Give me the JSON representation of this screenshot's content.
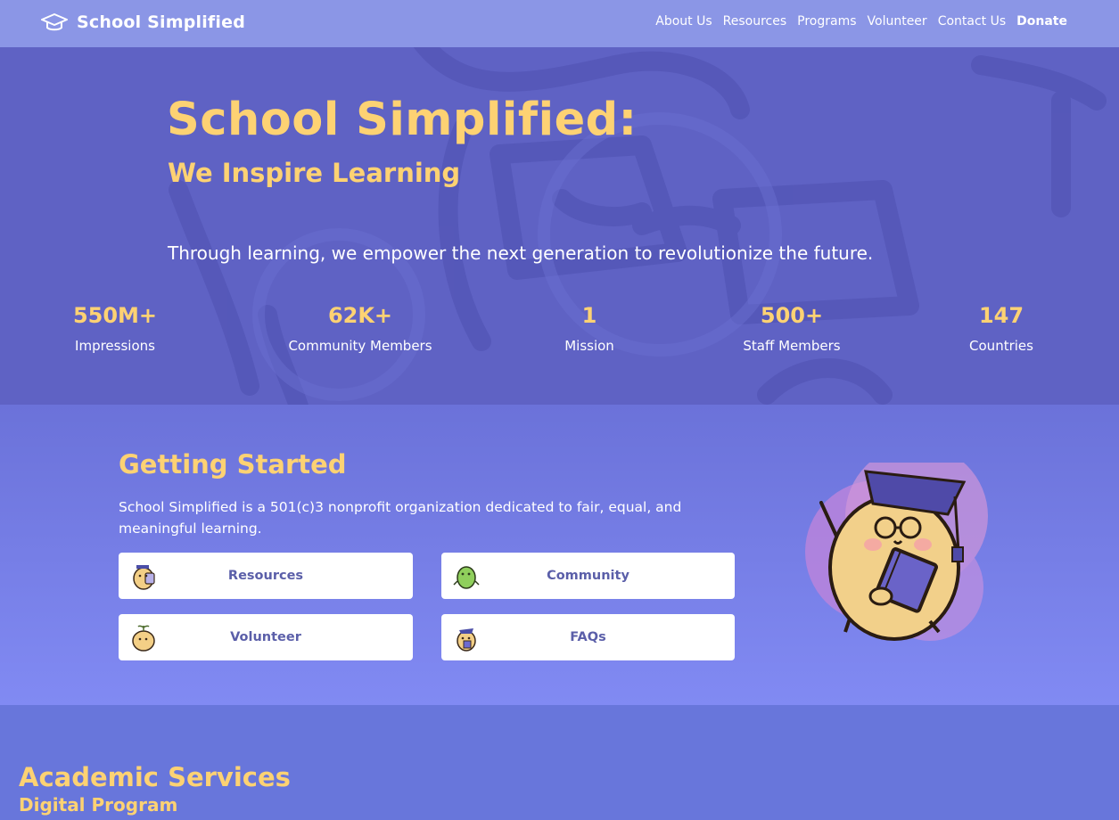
{
  "nav": {
    "brand": "School Simplified",
    "links": [
      "About Us",
      "Resources",
      "Programs",
      "Volunteer",
      "Contact Us"
    ],
    "donate": "Donate"
  },
  "hero": {
    "title": "School Simplified:",
    "subtitle": "We Inspire Learning",
    "tagline": "Through learning, we empower the next generation to revolutionize the future.",
    "stats": [
      {
        "value": "550M+",
        "label": "Impressions"
      },
      {
        "value": "62K+",
        "label": "Community Members"
      },
      {
        "value": "1",
        "label": "Mission"
      },
      {
        "value": "500+",
        "label": "Staff Members"
      },
      {
        "value": "147",
        "label": "Countries"
      }
    ]
  },
  "getting_started": {
    "title": "Getting Started",
    "description": "School Simplified is a 501(c)3 nonprofit organization dedicated to fair, equal, and meaningful learning.",
    "cards": [
      {
        "label": "Resources",
        "icon": "mascot-backpack-icon"
      },
      {
        "label": "Community",
        "icon": "mascot-green-icon"
      },
      {
        "label": "Volunteer",
        "icon": "mascot-sprout-icon"
      },
      {
        "label": "FAQs",
        "icon": "mascot-teacher-icon"
      }
    ]
  },
  "academic": {
    "title": "Academic Services",
    "subtitle": "Digital Program"
  },
  "colors": {
    "accent_yellow": "#fdd273",
    "nav_bg": "#8b96e6",
    "hero_bg": "#5f62c4",
    "card_text": "#5b5fa9"
  }
}
